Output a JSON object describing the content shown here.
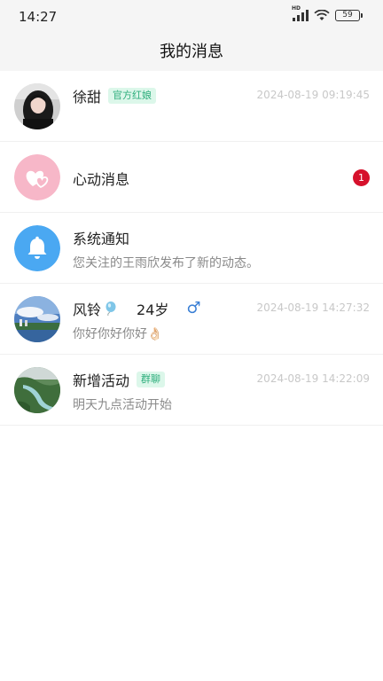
{
  "status_bar": {
    "time": "14:27",
    "battery": "59",
    "network": "HD"
  },
  "header": {
    "title": "我的消息"
  },
  "messages": [
    {
      "name": "徐甜",
      "tag": "官方红娘",
      "timestamp": "2024-08-19 09:19:45",
      "preview": ""
    },
    {
      "name": "心动消息",
      "unread": "1"
    },
    {
      "name": "系统通知",
      "preview": "您关注的王雨欣发布了新的动态。"
    },
    {
      "name": "风铃",
      "age": "24岁",
      "gender_symbol": "♂",
      "timestamp": "2024-08-19 14:27:32",
      "preview": "你好你好你好👌🏻"
    },
    {
      "name": "新增活动",
      "tag": "群聊",
      "timestamp": "2024-08-19 14:22:09",
      "preview": "明天九点活动开始"
    }
  ],
  "colors": {
    "background": "#ffffff",
    "header_background": "#f5f5f5",
    "tag_text": "#2fae7d",
    "tag_background": "#dcf7ea",
    "badge": "#d6112c",
    "heart_avatar": "#f7b7c8",
    "bell_avatar": "#4aa8f2",
    "male": "#3a7fd5"
  },
  "icons": [
    "signal-icon",
    "wifi-icon",
    "battery-icon",
    "heart-icon",
    "bell-icon",
    "balloon-icon",
    "male-icon"
  ]
}
